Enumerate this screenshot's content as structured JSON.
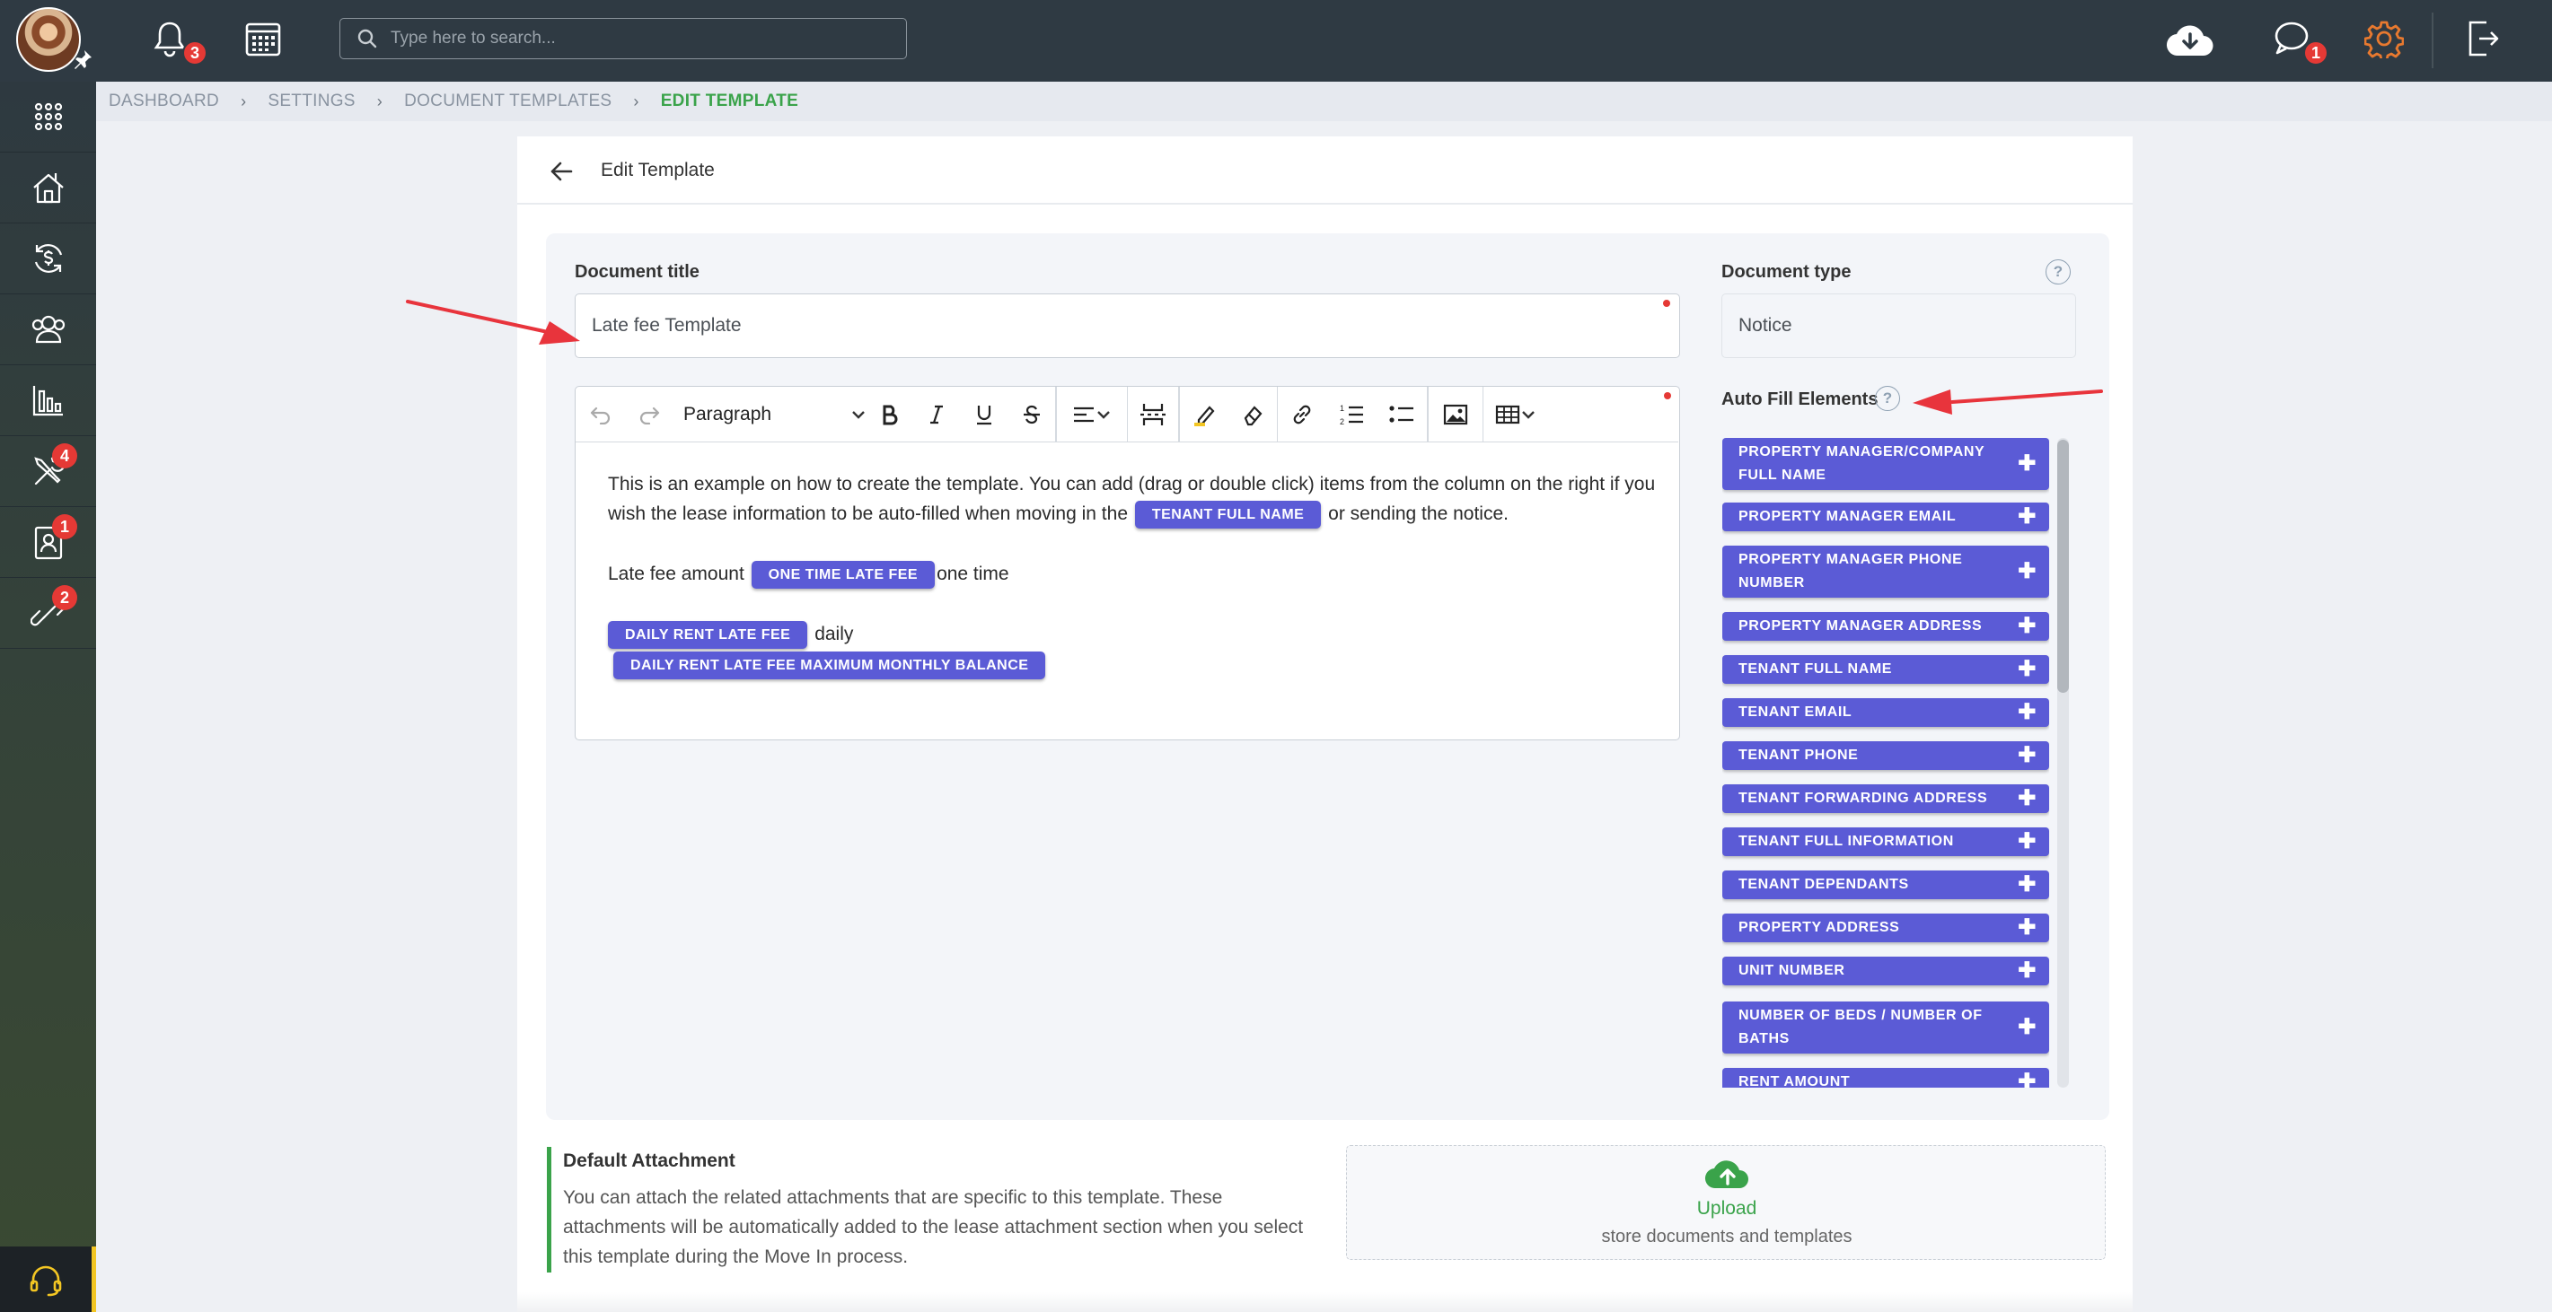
{
  "topbar": {
    "notifications_count": "3",
    "search_placeholder": "Type here to search...",
    "messages_count": "1",
    "accent_color": "#e8792f"
  },
  "sidebar": {
    "items": [
      {
        "icon": "apps-grid-icon"
      },
      {
        "icon": "properties-icon"
      },
      {
        "icon": "accounting-icon"
      },
      {
        "icon": "contacts-icon"
      },
      {
        "icon": "reports-icon"
      },
      {
        "icon": "maintenance-icon",
        "badge": "4"
      },
      {
        "icon": "applicants-icon",
        "badge": "1"
      },
      {
        "icon": "integrations-icon",
        "badge": "2"
      }
    ],
    "support_icon": "headset-icon"
  },
  "breadcrumb": {
    "items": [
      "DASHBOARD",
      "SETTINGS",
      "DOCUMENT TEMPLATES"
    ],
    "current": "EDIT TEMPLATE"
  },
  "page": {
    "title": "Edit Template"
  },
  "form": {
    "doc_title_label": "Document title",
    "doc_title_value": "Late fee Template",
    "doc_type_label": "Document type",
    "doc_type_value": "Notice",
    "autofill_label": "Auto Fill Elements"
  },
  "editor": {
    "paragraph_style": "Paragraph",
    "line1_text": "This is an example on how to create the template. You can add (drag or double click) items from the column on the right if you wish the lease information to be auto-filled when moving in the",
    "line1_chip": "TENANT FULL NAME",
    "line1_tail": "or sending the notice.",
    "line2_text": "Late fee amount",
    "line2_chip": "ONE TIME LATE FEE",
    "line2_tail": "one time",
    "line3_chip": "DAILY RENT LATE FEE",
    "line3_tail": "daily",
    "line4_chip": "DAILY RENT LATE FEE MAXIMUM MONTHLY BALANCE"
  },
  "autofill_elements": [
    "PROPERTY MANAGER/COMPANY FULL NAME",
    "PROPERTY MANAGER EMAIL",
    "PROPERTY MANAGER PHONE NUMBER",
    "PROPERTY MANAGER ADDRESS",
    "TENANT FULL NAME",
    "TENANT EMAIL",
    "TENANT PHONE",
    "TENANT FORWARDING ADDRESS",
    "TENANT FULL INFORMATION",
    "TENANT DEPENDANTS",
    "PROPERTY ADDRESS",
    "UNIT NUMBER",
    "NUMBER OF BEDS / NUMBER OF BATHS",
    "RENT AMOUNT"
  ],
  "attachment": {
    "title": "Default Attachment",
    "description": "You can attach the related attachments that are specific to this template. These attachments will be automatically added to the lease attachment section when you select this template during the Move In process.",
    "upload_label": "Upload",
    "upload_sub": "store documents and templates"
  },
  "colors": {
    "chip": "#5b5bd6",
    "success": "#3aa34a",
    "annotation_arrow": "#e8343c"
  }
}
